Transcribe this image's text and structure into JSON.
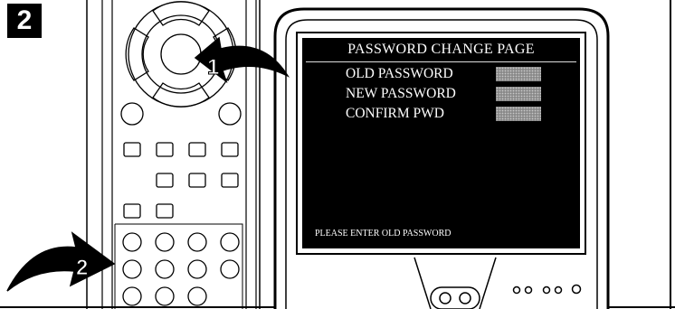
{
  "step_number": "2",
  "callouts": [
    "1",
    "2"
  ],
  "screen": {
    "title": "PASSWORD CHANGE PAGE",
    "fields": [
      {
        "label": "OLD PASSWORD"
      },
      {
        "label": "NEW PASSWORD"
      },
      {
        "label": "CONFIRM PWD"
      }
    ],
    "status": "PLEASE ENTER OLD PASSWORD"
  }
}
